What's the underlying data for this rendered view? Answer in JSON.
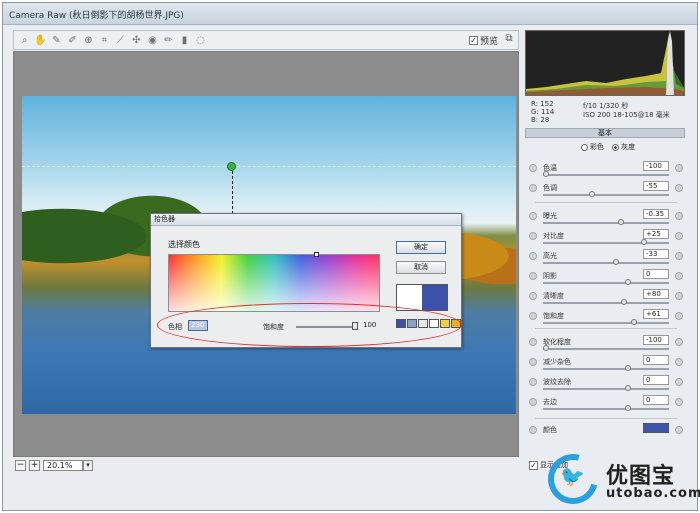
{
  "window": {
    "title": "Camera Raw (秋日倒影下的胡杨世界.JPG)"
  },
  "toolbar": {
    "tools": [
      "zoom-icon",
      "hand-icon",
      "white-balance-icon",
      "color-sampler-icon",
      "target-adjust-icon",
      "crop-icon",
      "straighten-icon",
      "spot-removal-icon",
      "red-eye-icon",
      "brush-icon",
      "gradient-icon",
      "rotate-icon"
    ],
    "preview_label": "预览",
    "preview_checked": true
  },
  "zoom": {
    "value": "20.1%"
  },
  "readout": {
    "r": "R:  152",
    "g": "G:  114",
    "b": "B:   28",
    "exif_line1": "f/10   1/320 秒",
    "exif_line2": "ISO 200   18-105@18 毫米"
  },
  "panel": {
    "tab_label": "基本",
    "mode_color": "彩色",
    "mode_gray": "灰度",
    "selected_mode": "灰度",
    "rows": [
      {
        "label": "色温",
        "value": "-100"
      },
      {
        "label": "色调",
        "value": "-55"
      },
      {
        "label": "曝光",
        "value": "-0.35"
      },
      {
        "label": "对比度",
        "value": "+25"
      },
      {
        "label": "高光",
        "value": "-33"
      },
      {
        "label": "阴影",
        "value": "0"
      },
      {
        "label": "清晰度",
        "value": "+80"
      },
      {
        "label": "饱和度",
        "value": "+61"
      },
      {
        "label": "软化程度",
        "value": "-100"
      },
      {
        "label": "减少杂色",
        "value": "0"
      },
      {
        "label": "波纹去除",
        "value": "0"
      },
      {
        "label": "去边",
        "value": "0"
      }
    ],
    "color_label": "颜色",
    "show_overlay_label": "显示叠加",
    "show_overlay_checked": true
  },
  "dialog": {
    "title": "拾色器",
    "subtitle": "选择颜色",
    "ok_label": "确定",
    "cancel_label": "取消",
    "hue_label": "色相",
    "hue_value": "230",
    "saturation_label": "饱和度",
    "saturation_value": "100",
    "saturation_level_percent": 100,
    "selected_color": "#3b52a8",
    "swatches": [
      "#3b52a8",
      "#8aa0c8",
      "#e8e8e8",
      "#ffffff",
      "#f0d040",
      "#e8b020"
    ]
  },
  "watermark": {
    "name": "优图宝",
    "url": "utobao.com"
  }
}
